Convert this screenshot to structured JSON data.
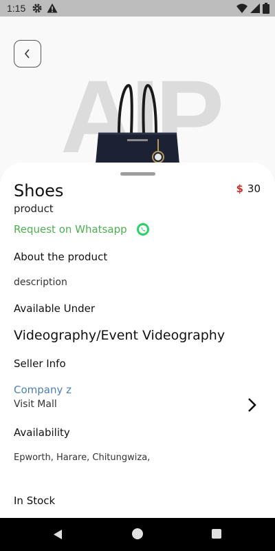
{
  "status_bar": {
    "time": "1:15",
    "left_icons": [
      "gear-icon",
      "warning-icon"
    ],
    "right_icons": [
      "wifi-icon",
      "signal-icon",
      "battery-icon"
    ]
  },
  "hero": {
    "watermark": "AIP",
    "image": "handbag-image"
  },
  "product": {
    "title": "Shoes",
    "price_currency": "$",
    "price_value": "30",
    "subtitle": "product",
    "whatsapp_label": "Request on Whatsapp"
  },
  "about": {
    "heading": "About the product",
    "description": "description"
  },
  "available_under": {
    "heading": "Available Under",
    "category": "Videography/Event Videography"
  },
  "seller": {
    "heading": "Seller Info",
    "company": "Company z",
    "visit_label": "Visit Mall"
  },
  "availability": {
    "heading": "Availability",
    "locations": "Epworth, Harare, Chitungwiza,"
  },
  "stock": {
    "label": "In Stock"
  },
  "colors": {
    "whatsapp_green": "#4caf50",
    "company_blue": "#4a7fb5",
    "currency_red": "#d32f2f"
  }
}
